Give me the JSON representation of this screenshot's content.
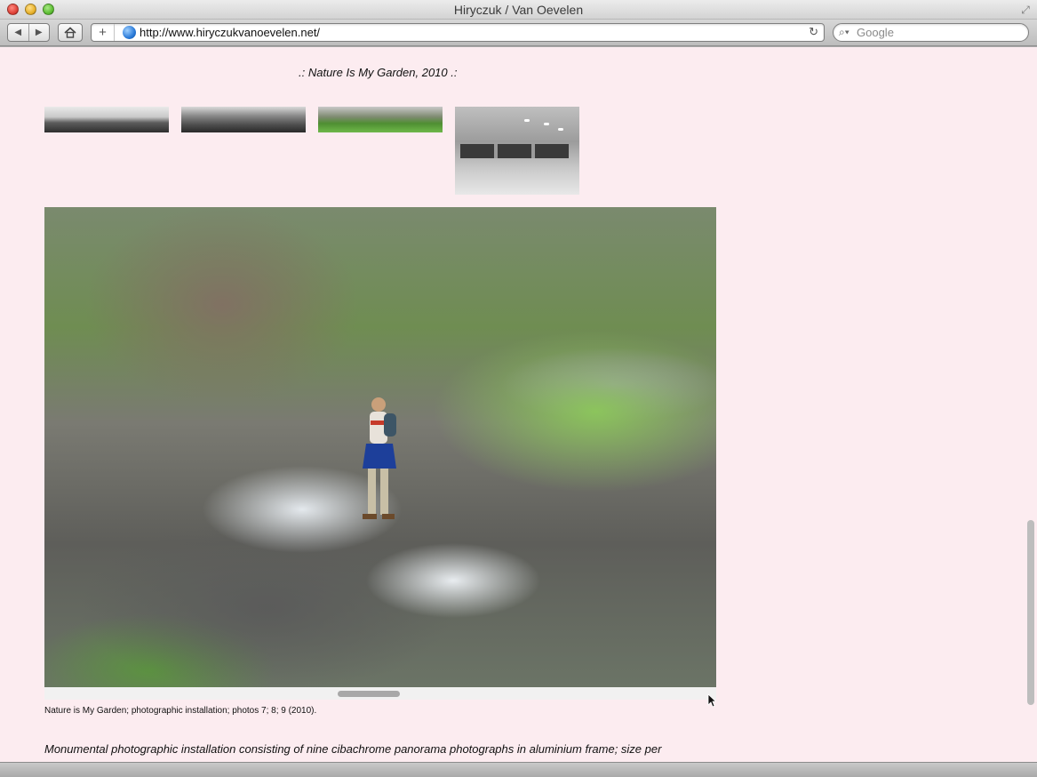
{
  "window": {
    "title": "Hiryczuk / Van Oevelen"
  },
  "toolbar": {
    "url": "http://www.hiryczukvanoevelen.net/",
    "search_placeholder": "Google"
  },
  "page": {
    "heading": ".: Nature Is My Garden, 2010 .:",
    "thumbnails": [
      "thumbnail-1",
      "thumbnail-2",
      "thumbnail-3",
      "thumbnail-4"
    ],
    "photo_caption": "Nature is My Garden; photographic installation; photos 7; 8; 9 (2010).",
    "description": "Monumental photographic installation consisting of nine cibachrome panorama photographs in aluminium frame; size per"
  },
  "colors": {
    "page_background": "#fcecf0",
    "text": "#111111"
  }
}
